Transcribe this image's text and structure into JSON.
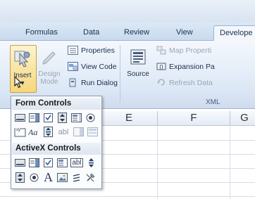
{
  "tabs": [
    {
      "label": "Formulas"
    },
    {
      "label": "Data"
    },
    {
      "label": "Review"
    },
    {
      "label": "View"
    },
    {
      "label": "Develope",
      "active": true
    }
  ],
  "ribbon": {
    "insert_label": "Insert",
    "insert_caret": "▾",
    "design_mode_label": "Design\nMode",
    "properties_label": "Properties",
    "view_code_label": "View Code",
    "run_dialog_label": "Run Dialog",
    "source_label": "Source",
    "map_properties_label": "Map Properti",
    "expansion_packs_label": "Expansion Pa",
    "refresh_data_label": "Refresh Data",
    "xml_group_label": "XML"
  },
  "dropdown": {
    "form_controls_title": "Form Controls",
    "activex_controls_title": "ActiveX Controls",
    "form_row2_text_label": "abl",
    "activex_row1_text_label": "abl",
    "activex_row2_a_label": "A"
  },
  "sheet": {
    "columns": [
      "E",
      "F",
      "G"
    ]
  },
  "colors": {
    "active_tab_bg": "#f3f7fc",
    "insert_highlight": "#f7d77b",
    "ribbon_bg": "#dde8f6"
  },
  "icons": [
    "insert-controls-icon",
    "design-mode-icon",
    "properties-icon",
    "view-code-icon",
    "run-dialog-icon",
    "source-icon",
    "map-properties-icon",
    "expansion-packs-icon",
    "refresh-data-icon",
    "mouse-cursor-icon"
  ]
}
